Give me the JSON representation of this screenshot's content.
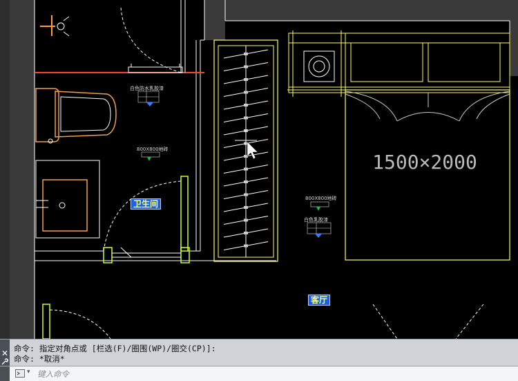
{
  "drawing": {
    "bed_dimension": "1500×2000",
    "room_tags": {
      "bathroom": "卫生间",
      "living_room": "客厅"
    },
    "annotations": {
      "bath_floor": "白色防水乳胶漆",
      "bath_ceiling": "800X800地砖",
      "bed_floor": "800X800地砖",
      "bed_wall": "白色乳胶漆"
    }
  },
  "command": {
    "history": [
      "命令: 指定对角点或 [栏选(F)/圈围(WP)/圈交(CP)]:",
      "命令: *取消*"
    ],
    "input_placeholder": "键入命令",
    "close_glyph": "✕"
  },
  "colors": {
    "background": "#000000",
    "wall_fill": "#3a3a3a",
    "line_white": "#ffffff",
    "line_yellow": "#ffff66",
    "fixture_orange": "#f0a050",
    "pipe_red": "#ff4422",
    "tag_blue": "#1e5fe0"
  }
}
